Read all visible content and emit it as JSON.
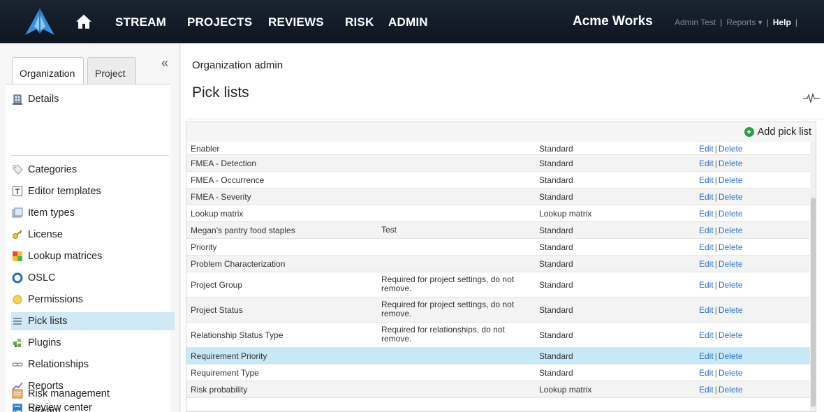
{
  "nav": {
    "items": [
      "STREAM",
      "PROJECTS",
      "REVIEWS",
      "RISK",
      "ADMIN"
    ],
    "company": "Acme Works",
    "user": "Admin Test",
    "reports": "Reports",
    "help": "Help"
  },
  "sidebar": {
    "tabs": [
      "Organization",
      "Project"
    ],
    "collapse_glyph": "«",
    "items": [
      {
        "label": "Details",
        "icon": "building-icon"
      },
      {
        "label": "Categories",
        "icon": "tag-icon"
      },
      {
        "label": "Editor templates",
        "icon": "template-icon"
      },
      {
        "label": "Item types",
        "icon": "item-types-icon"
      },
      {
        "label": "License",
        "icon": "key-icon"
      },
      {
        "label": "Lookup matrices",
        "icon": "matrix-icon"
      },
      {
        "label": "OSLC",
        "icon": "oslc-icon"
      },
      {
        "label": "Permissions",
        "icon": "permissions-icon"
      },
      {
        "label": "Pick lists",
        "icon": "list-icon"
      },
      {
        "label": "Plugins",
        "icon": "plugin-icon"
      },
      {
        "label": "Relationships",
        "icon": "link-icon"
      },
      {
        "label": "Reports",
        "icon": "chart-icon"
      },
      {
        "label": "Review center",
        "icon": "review-icon"
      },
      {
        "label": "Risk management",
        "icon": "risk-icon"
      },
      {
        "label": "Stream",
        "icon": "stream-icon"
      }
    ]
  },
  "main": {
    "breadcrumb": "Organization admin",
    "title": "Pick lists",
    "add_label": "Add pick list",
    "actions": {
      "edit": "Edit",
      "delete": "Delete"
    },
    "rows": [
      {
        "name": "Enabler",
        "description": "",
        "type": "Standard"
      },
      {
        "name": "FMEA - Detection",
        "description": "",
        "type": "Standard"
      },
      {
        "name": "FMEA - Occurrence",
        "description": "",
        "type": "Standard"
      },
      {
        "name": "FMEA - Severity",
        "description": "",
        "type": "Standard"
      },
      {
        "name": "Lookup matrix",
        "description": "",
        "type": "Lookup matrix"
      },
      {
        "name": "Megan's pantry food staples",
        "description": "Test",
        "type": "Standard"
      },
      {
        "name": "Priority",
        "description": "",
        "type": "Standard"
      },
      {
        "name": "Problem Characterization",
        "description": "",
        "type": "Standard"
      },
      {
        "name": "Project Group",
        "description": "Required for project settings, do not remove.",
        "type": "Standard"
      },
      {
        "name": "Project Status",
        "description": "Required for project settings, do not remove.",
        "type": "Standard"
      },
      {
        "name": "Relationship Status Type",
        "description": "Required for relationships, do not remove.",
        "type": "Standard"
      },
      {
        "name": "Requirement Priority",
        "description": "",
        "type": "Standard"
      },
      {
        "name": "Requirement Type",
        "description": "",
        "type": "Standard"
      },
      {
        "name": "Risk probability",
        "description": "",
        "type": "Lookup matrix"
      }
    ],
    "selected_row": "Requirement Priority"
  },
  "colors": {
    "topbar": "#0d1520",
    "selection": "#c7e8f7",
    "link": "#2a72c9",
    "add_icon": "#2d9a46"
  }
}
